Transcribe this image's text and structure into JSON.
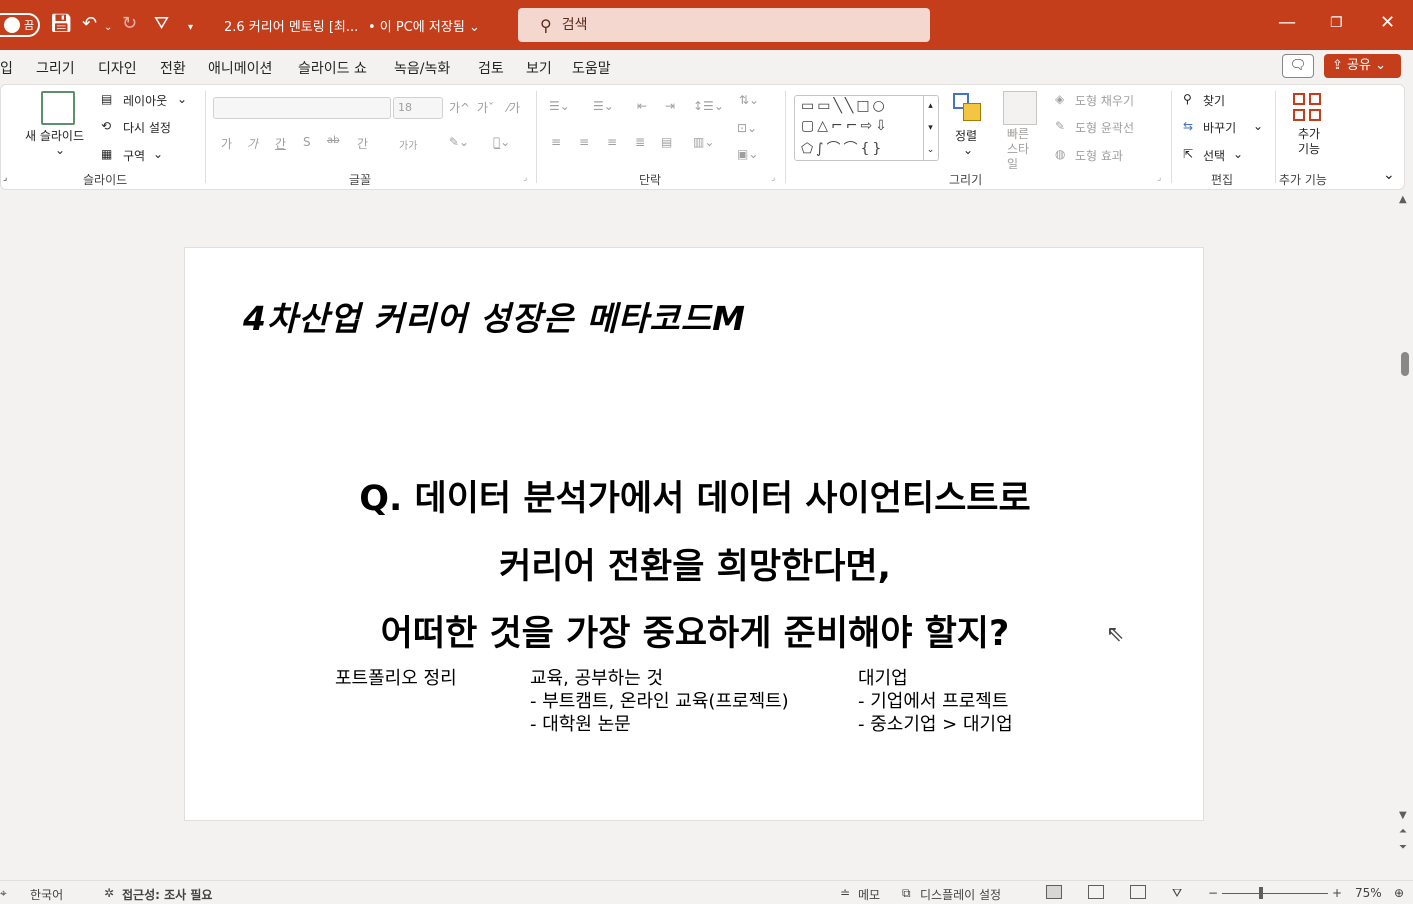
{
  "titlebar": {
    "toggle_label": "끔",
    "doc_title": "2.6 커리어 멘토링 [최...",
    "save_state": "• 이 PC에 저장됨",
    "search_placeholder": "검색",
    "search_icon": "search-icon",
    "bg_color": "#c43e1c"
  },
  "menu": {
    "tabs": [
      "입",
      "그리기",
      "디자인",
      "전환",
      "애니메이션",
      "슬라이드 쇼",
      "녹음/녹화",
      "검토",
      "보기",
      "도움말"
    ],
    "share_label": "공유"
  },
  "ribbon": {
    "slides": {
      "new_slide": "새 슬라이드",
      "layout": "레이아웃",
      "reset": "다시 설정",
      "section": "구역",
      "group_label": "슬라이드"
    },
    "font": {
      "size": "18",
      "group_label": "글꼴",
      "glyphs": [
        "가",
        "가",
        "간",
        "S",
        "ab",
        "간",
        "가가"
      ]
    },
    "paragraph": {
      "group_label": "단락"
    },
    "drawing": {
      "arrange": "정렬",
      "quick_styles": "빠른 스타일",
      "shape_fill": "도형 채우기",
      "shape_outline": "도형 윤곽선",
      "shape_effects": "도형 효과",
      "group_label": "그리기"
    },
    "editing": {
      "find": "찾기",
      "replace": "바꾸기",
      "select": "선택",
      "group_label": "편집"
    },
    "addins": {
      "button": "추가 기능",
      "group_label": "추가 기능"
    }
  },
  "slide": {
    "title": "4차산업 커리어 성장은 메타코드M",
    "question_lines": [
      "Q. 데이터 분석가에서 데이터 사이언티스트로",
      "커리어 전환을 희망한다면,",
      "어떠한 것을 가장 중요하게 준비해야 할지?"
    ],
    "notes": {
      "col1": [
        "포트폴리오 정리"
      ],
      "col2": [
        "교육, 공부하는 것",
        "- 부트캠트, 온라인 교육(프로젝트)",
        "- 대학원 논문"
      ],
      "col3": [
        "대기업",
        "- 기업에서 프로젝트",
        "- 중소기업 > 대기업"
      ]
    }
  },
  "status": {
    "language": "한국어",
    "accessibility": "접근성: 조사 필요",
    "notes": "메모",
    "display_settings": "디스플레이 설정",
    "zoom": "75%"
  }
}
